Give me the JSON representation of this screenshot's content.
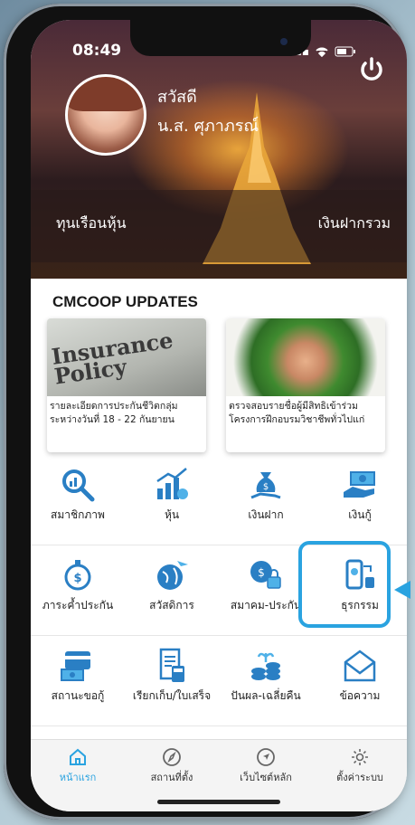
{
  "status_bar": {
    "time": "08:49"
  },
  "profile": {
    "greeting": "สวัสดี",
    "name": "น.ส. ศุภาภรณ์"
  },
  "hero": {
    "left_label": "ทุนเรือนหุ้น",
    "right_label": "เงินฝากรวม"
  },
  "updates": {
    "title": "CMCOOP UPDATES",
    "items": [
      {
        "image_text": "Insurance Policy",
        "caption": "รายละเอียดการประกันชีวิตกลุ่ม ระหว่างวันที่ 18 - 22 กันยายน"
      },
      {
        "caption": "ตรวจสอบรายชื่อผู้มีสิทธิเข้าร่วม โครงการฝึกอบรมวิชาชีพทั่วไปแก่"
      }
    ]
  },
  "menu": [
    {
      "label": "สมาชิกภาพ",
      "icon": "magnifier-chart-icon"
    },
    {
      "label": "หุ้น",
      "icon": "bar-chart-icon"
    },
    {
      "label": "เงินฝาก",
      "icon": "money-bag-hand-icon"
    },
    {
      "label": "เงินกู้",
      "icon": "cash-hand-icon"
    },
    {
      "label": "ภาระค้ำประกัน",
      "icon": "stopwatch-coin-icon"
    },
    {
      "label": "สวัสดิการ",
      "icon": "globe-plane-icon"
    },
    {
      "label": "สมาคม-ประกัน",
      "icon": "coin-lock-icon"
    },
    {
      "label": "ธุรกรรม",
      "icon": "phone-transfer-icon"
    },
    {
      "label": "สถานะขอกู้",
      "icon": "card-cash-icon"
    },
    {
      "label": "เรียกเก็บ/ใบเสร็จ",
      "icon": "receipt-calculator-icon"
    },
    {
      "label": "ปันผล-เฉลี่ยคืน",
      "icon": "coins-plant-icon"
    },
    {
      "label": "ข้อความ",
      "icon": "envelope-icon"
    }
  ],
  "bottom_nav": [
    {
      "label": "หน้าแรก",
      "icon": "home-icon",
      "active": true
    },
    {
      "label": "สถานที่ตั้ง",
      "icon": "compass-icon",
      "active": false
    },
    {
      "label": "เว็บไซต์หลัก",
      "icon": "navigation-arrow-icon",
      "active": false
    },
    {
      "label": "ตั้งค่าระบบ",
      "icon": "gear-icon",
      "active": false
    }
  ],
  "colors": {
    "accent": "#2aa3e0",
    "icon_blue": "#2a7fc4"
  }
}
